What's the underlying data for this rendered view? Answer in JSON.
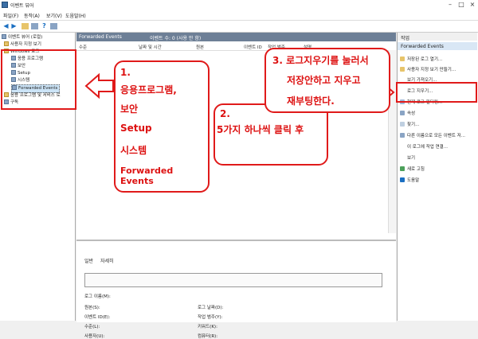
{
  "window": {
    "title": "이벤트 뷰어"
  },
  "menu": [
    "파일(F)",
    "동작(A)",
    "보기(V)",
    "도움말(H)"
  ],
  "tree": {
    "root": "이벤트 뷰어 (로컬)",
    "custom_views": "사용자 지정 보기",
    "windows_logs": "Windows 로그",
    "children": [
      "응용 프로그램",
      "보안",
      "Setup",
      "시스템",
      "Forwarded Events"
    ],
    "app_services": "응용 프로그램 및 서비스 로",
    "subscriptions": "구독"
  },
  "center": {
    "header_title": "Forwarded Events",
    "header_count": "이벤트 수: 0 (사용 안 함)",
    "columns": [
      "수준",
      "날짜 및 시간",
      "원본",
      "이벤트 ID",
      "작업 범주"
    ],
    "col_partial": "설명",
    "bottom": {
      "tabs": [
        "일반",
        "자세히"
      ],
      "fields_left": [
        "로그 이름(M):",
        "원본(S):",
        "이벤트 ID(E):",
        "수준(L):",
        "사용자(U):"
      ],
      "fields_right": [
        "로그 날짜(D):",
        "작업 범주(Y):",
        "키워드(K):",
        "컴퓨터(R):"
      ]
    }
  },
  "actions": {
    "header": "작업",
    "subheader": "Forwarded Events",
    "items": [
      "저장된 로그 열기...",
      "사용자 지정 보기 만들기...",
      "보기 가져오기...",
      "로그 지우기...",
      "현재 로그 필터링...",
      "속성",
      "찾기...",
      "다른 이름으로 모든 이벤트 저...",
      "이 로그에 작업 연결...",
      "보기",
      "새로 고침",
      "도움말"
    ]
  },
  "annotations": {
    "box1_lines": [
      "1.",
      "응용프로그램,",
      "보안",
      "Setup",
      "시스템",
      "Forwarded Events"
    ],
    "box2_lines": [
      "2.",
      "5가지 하나씩 클릭 후"
    ],
    "box3_lines": [
      "3. 로그지우기를 눌러서",
      "저장안하고 지우고",
      "재부팅한다."
    ]
  },
  "colors": {
    "annotation_red": "#e01a1a",
    "header_bg": "#6d7f96",
    "selection": "#cce4f7"
  }
}
